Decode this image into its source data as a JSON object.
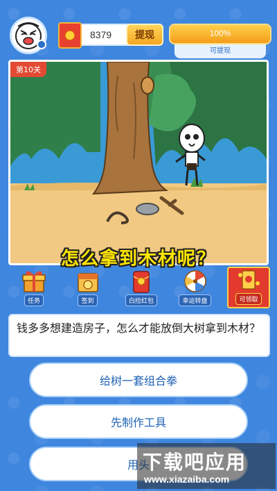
{
  "header": {
    "coins": "8379",
    "withdraw_label": "提现",
    "progress_percent": 100,
    "progress_text": "100%",
    "progress_caption": "可提现",
    "accent_color": "#f5a623"
  },
  "scene": {
    "level_label": "第10关",
    "question_title": "怎么拿到木材呢？"
  },
  "toolbar": {
    "items": [
      {
        "label": "任务",
        "icon": "gift-box-icon"
      },
      {
        "label": "签到",
        "icon": "calendar-check-icon"
      },
      {
        "label": "白捡红包",
        "icon": "red-envelope-icon"
      },
      {
        "label": "幸运转盘",
        "icon": "lucky-wheel-icon"
      },
      {
        "label": "可领取",
        "icon": "red-packet-open-icon"
      }
    ]
  },
  "question": {
    "text": "钱多多想建造房子，怎么才能放倒大树拿到木材？"
  },
  "answers": [
    {
      "label": "给树一套组合拳"
    },
    {
      "label": "先制作工具"
    },
    {
      "label": "用头"
    }
  ],
  "watermark": {
    "title": "下载吧应用",
    "url": "www.xiazaiba.com"
  }
}
